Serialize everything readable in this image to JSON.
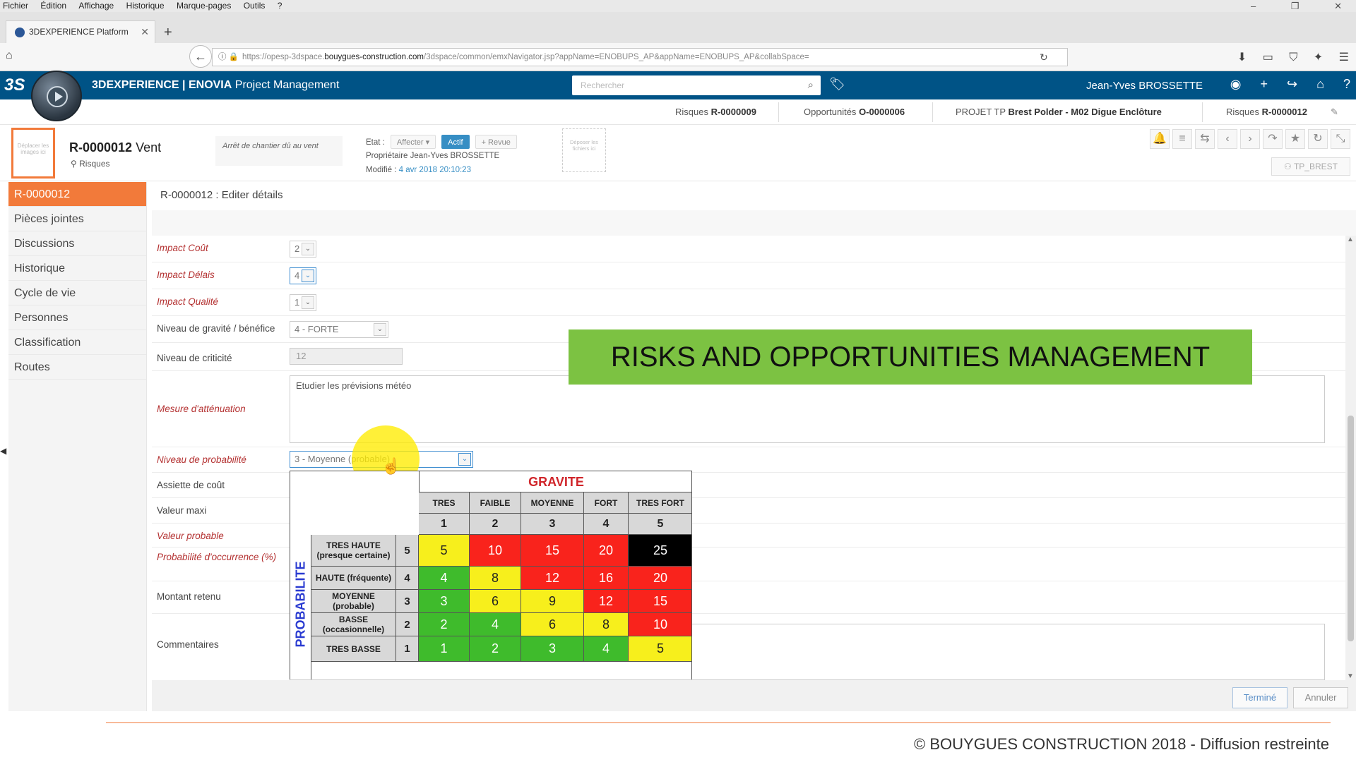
{
  "browser": {
    "menu": [
      "Fichier",
      "Édition",
      "Affichage",
      "Historique",
      "Marque-pages",
      "Outils",
      "?"
    ],
    "window_controls": [
      "–",
      "❐",
      "✕"
    ],
    "tab_title": "3DEXPERIENCE Platform",
    "url_prefix": "https://opesp-3dspace.",
    "url_domain": "bouygues-construction.com",
    "url_suffix": "/3dspace/common/emxNavigator.jsp?appName=ENOBUPS_AP&appName=ENOBUPS_AP&collabSpace="
  },
  "app": {
    "logo": "3S",
    "title_brand": "3DEXPERIENCE | ENOVIA",
    "title_app": "Project Management",
    "search_placeholder": "Rechercher",
    "user": "Jean-Yves BROSSETTE"
  },
  "breadcrumbs": [
    {
      "label": "Risques",
      "id": "R-0000009"
    },
    {
      "label": "Opportunités",
      "id": "O-0000006"
    },
    {
      "label": "PROJET TP",
      "id": "Brest Polder - M02 Digue Enclôture"
    },
    {
      "label": "Risques",
      "id": "R-0000012"
    }
  ],
  "object": {
    "thumb_text": "Déplacer les images ici",
    "id": "R-0000012",
    "name": "Vent",
    "type": "Risques",
    "description": "Arrêt de chantier dû au vent",
    "state_label": "Etat :",
    "btn_affect": "Affecter ▾",
    "btn_active": "Actif",
    "btn_revue": "+ Revue",
    "owner_label": "Propriétaire",
    "owner": "Jean-Yves BROSSETTE",
    "modified_label": "Modifié :",
    "modified": "4 avr 2018 20:10:23",
    "dropzone_text": "Déposer les fichiers ici",
    "tp_button": "TP_BREST"
  },
  "sidebar": {
    "items": [
      {
        "label": "R-0000012"
      },
      {
        "label": "Pièces jointes"
      },
      {
        "label": "Discussions"
      },
      {
        "label": "Historique"
      },
      {
        "label": "Cycle de vie"
      },
      {
        "label": "Personnes"
      },
      {
        "label": "Classification"
      },
      {
        "label": "Routes"
      }
    ]
  },
  "form": {
    "title": "R-0000012 : Editer détails",
    "fields": {
      "impact_cout": {
        "label": "Impact Coût",
        "value": "2"
      },
      "impact_delais": {
        "label": "Impact Délais",
        "value": "4"
      },
      "impact_qualite": {
        "label": "Impact Qualité",
        "value": "1"
      },
      "gravite": {
        "label": "Niveau de gravité / bénéfice",
        "value": "4 - FORTE"
      },
      "criticite": {
        "label": "Niveau de criticité",
        "value": "12"
      },
      "mesure": {
        "label": "Mesure d'atténuation",
        "value": "Etudier les prévisions météo"
      },
      "probabilite": {
        "label": "Niveau de probabilité",
        "value": "3 - Moyenne (probable)"
      },
      "assiette": {
        "label": "Assiette de coût"
      },
      "valeur_maxi": {
        "label": "Valeur maxi"
      },
      "valeur_probable": {
        "label": "Valeur probable"
      },
      "proba_occurrence": {
        "label": "Probabilité d'occurrence (%)"
      },
      "montant": {
        "label": "Montant retenu"
      },
      "commentaires": {
        "label": "Commentaires"
      }
    },
    "btn_done": "Terminé",
    "btn_cancel": "Annuler"
  },
  "banner": "RISKS AND OPPORTUNITIES MANAGEMENT",
  "matrix": {
    "title": "GRAVITE",
    "axis_label": "PROBABILITE",
    "columns": [
      "TRES FAIBLE",
      "FAIBLE",
      "MOYENNE",
      "FORT",
      "TRES FORT"
    ],
    "column_numbers": [
      "1",
      "2",
      "3",
      "4",
      "5"
    ],
    "rows": [
      {
        "label": "TRES HAUTE (presque certaine)",
        "num": "5",
        "values": [
          "5",
          "10",
          "15",
          "20",
          "25"
        ],
        "colors": [
          "#f7ef1c",
          "#f9231c",
          "#f9231c",
          "#f9231c",
          "#000000"
        ]
      },
      {
        "label": "HAUTE (fréquente)",
        "num": "4",
        "values": [
          "4",
          "8",
          "12",
          "16",
          "20"
        ],
        "colors": [
          "#3fbb2c",
          "#f7ef1c",
          "#f9231c",
          "#f9231c",
          "#f9231c"
        ]
      },
      {
        "label": "MOYENNE (probable)",
        "num": "3",
        "values": [
          "3",
          "6",
          "9",
          "12",
          "15"
        ],
        "colors": [
          "#3fbb2c",
          "#f7ef1c",
          "#f7ef1c",
          "#f9231c",
          "#f9231c"
        ]
      },
      {
        "label": "BASSE (occasionnelle)",
        "num": "2",
        "values": [
          "2",
          "4",
          "6",
          "8",
          "10"
        ],
        "colors": [
          "#3fbb2c",
          "#3fbb2c",
          "#f7ef1c",
          "#f7ef1c",
          "#f9231c"
        ]
      },
      {
        "label": "TRES BASSE",
        "num": "1",
        "values": [
          "1",
          "2",
          "3",
          "4",
          "5"
        ],
        "colors": [
          "#3fbb2c",
          "#3fbb2c",
          "#3fbb2c",
          "#3fbb2c",
          "#f7ef1c"
        ]
      }
    ]
  },
  "footer": "© BOUYGUES CONSTRUCTION 2018 - Diffusion restreinte"
}
